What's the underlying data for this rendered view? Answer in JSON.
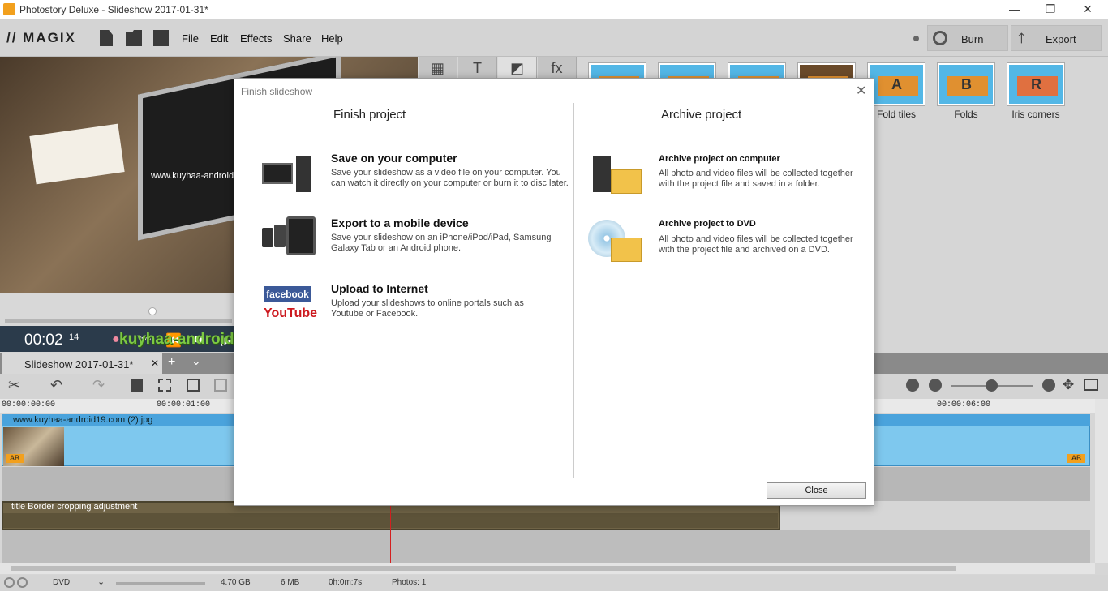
{
  "window": {
    "title": "Photostory Deluxe - Slideshow 2017-01-31*",
    "minimize": "—",
    "restore": "❐",
    "close": "✕"
  },
  "menubar": {
    "logo": "// MAGIX",
    "menus": [
      "File",
      "Edit",
      "Effects",
      "Share",
      "Help"
    ],
    "burn_label": "Burn",
    "export_label": "Export"
  },
  "preview": {
    "watermark": "www.kuyhaa-android19.com"
  },
  "transport": {
    "timecode": "00:02",
    "frames": "14",
    "watermark_logo": "kuyhaa-android19"
  },
  "effects": {
    "tabs": [
      "▦",
      "T",
      "◩",
      "fx"
    ],
    "transitions": [
      {
        "name": "Fold tiles",
        "letter": "A"
      },
      {
        "name": "Folds",
        "letter": "B"
      },
      {
        "name": "Iris corners",
        "letter": "R"
      }
    ]
  },
  "timeline": {
    "tab_label": "Slideshow 2017-01-31*",
    "tab_close": "✕",
    "tab_add": "+",
    "tab_dropdown": "⌄",
    "ruler": [
      "00:00:00:00",
      "00:00:01:00",
      "00:00:06:00"
    ],
    "clip_name": "www.kuyhaa-android19.com (2).jpg",
    "ab_label": "AB",
    "title_track": "title   Border cropping adjustment"
  },
  "status": {
    "disc": "DVD",
    "capacity": "4.70 GB",
    "size": "6 MB",
    "duration": "0h:0m:7s",
    "photos": "Photos: 1"
  },
  "dialog": {
    "title": "Finish slideshow",
    "close_x": "✕",
    "left_heading": "Finish project",
    "right_heading": "Archive project",
    "finish_items": [
      {
        "title": "Save on your computer",
        "desc": "Save your slideshow as a video file on your computer. You can watch it directly on your computer or burn it to disc later."
      },
      {
        "title": "Export to a mobile device",
        "desc": "Save your slideshow on an iPhone/iPod/iPad, Samsung Galaxy Tab or an Android phone."
      },
      {
        "title": "Upload to Internet",
        "desc": "Upload your slideshows to online portals such as Youtube or Facebook."
      }
    ],
    "archive_items": [
      {
        "title": "Archive project on computer",
        "desc": "All photo and video files will be collected together with the project file and saved in a folder."
      },
      {
        "title": "Archive project to DVD",
        "desc": "All photo and video files will be collected together with the project file and archived on a DVD."
      }
    ],
    "facebook_label": "facebook",
    "youtube_label": "YouTube",
    "close_button": "Close"
  }
}
